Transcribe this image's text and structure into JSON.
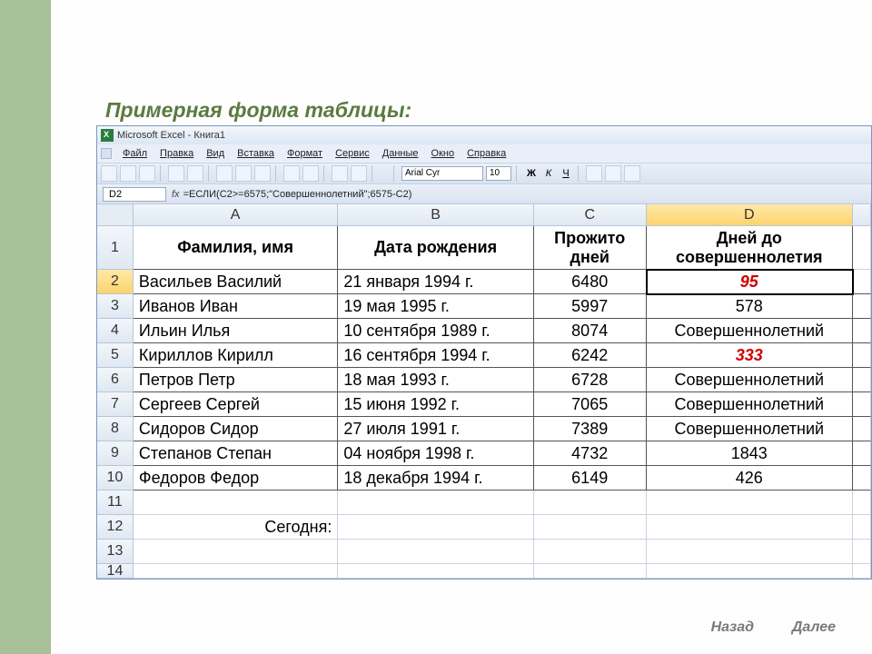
{
  "slide": {
    "title": "Примерная форма таблицы:",
    "nav_back": "Назад",
    "nav_next": "Далее"
  },
  "excel": {
    "window_title": "Microsoft Excel - Книга1",
    "menus": [
      "Файл",
      "Правка",
      "Вид",
      "Вставка",
      "Формат",
      "Сервис",
      "Данные",
      "Окно",
      "Справка"
    ],
    "font_name": "Arial Cyr",
    "font_size": "10",
    "bold": "Ж",
    "italic": "К",
    "underline": "Ч",
    "namebox": "D2",
    "formula": "=ЕСЛИ(C2>=6575;\"Совершеннолетний\";6575-C2)",
    "columns": [
      "A",
      "B",
      "C",
      "D"
    ],
    "headers": {
      "A": "Фамилия, имя",
      "B": "Дата рождения",
      "C": "Прожито дней",
      "D": "Дней до совершеннолетия"
    },
    "rows": [
      {
        "n": "2",
        "a": "Васильев Василий",
        "b": "21 января 1994 г.",
        "c": "6480",
        "d": "95",
        "d_red": true
      },
      {
        "n": "3",
        "a": "Иванов Иван",
        "b": "19 мая 1995 г.",
        "c": "5997",
        "d": "578"
      },
      {
        "n": "4",
        "a": "Ильин Илья",
        "b": "10 сентября 1989 г.",
        "c": "8074",
        "d": "Совершеннолетний"
      },
      {
        "n": "5",
        "a": "Кириллов Кирилл",
        "b": "16 сентября 1994 г.",
        "c": "6242",
        "d": "333",
        "d_red": true
      },
      {
        "n": "6",
        "a": "Петров Петр",
        "b": "18 мая 1993 г.",
        "c": "6728",
        "d": "Совершеннолетний"
      },
      {
        "n": "7",
        "a": "Сергеев Сергей",
        "b": "15 июня 1992 г.",
        "c": "7065",
        "d": "Совершеннолетний"
      },
      {
        "n": "8",
        "a": "Сидоров Сидор",
        "b": "27 июля 1991 г.",
        "c": "7389",
        "d": "Совершеннолетний"
      },
      {
        "n": "9",
        "a": "Степанов Степан",
        "b": "04 ноября 1998 г.",
        "c": "4732",
        "d": "1843"
      },
      {
        "n": "10",
        "a": "Федоров Федор",
        "b": "18 декабря 1994 г.",
        "c": "6149",
        "d": "426"
      }
    ],
    "today_label": "Сегодня:",
    "empty_rows": [
      "11",
      "12",
      "13",
      "14"
    ],
    "chart_data": {
      "type": "table",
      "title": "Примерная форма таблицы",
      "columns": [
        "Фамилия, имя",
        "Дата рождения",
        "Прожито дней",
        "Дней до совершеннолетия"
      ],
      "data": [
        [
          "Васильев Василий",
          "21 января 1994 г.",
          6480,
          95
        ],
        [
          "Иванов Иван",
          "19 мая 1995 г.",
          5997,
          578
        ],
        [
          "Ильин Илья",
          "10 сентября 1989 г.",
          8074,
          "Совершеннолетний"
        ],
        [
          "Кириллов Кирилл",
          "16 сентября 1994 г.",
          6242,
          333
        ],
        [
          "Петров Петр",
          "18 мая 1993 г.",
          6728,
          "Совершеннолетний"
        ],
        [
          "Сергеев Сергей",
          "15 июня 1992 г.",
          7065,
          "Совершеннолетний"
        ],
        [
          "Сидоров Сидор",
          "27 июля 1991 г.",
          7389,
          "Совершеннолетний"
        ],
        [
          "Степанов Степан",
          "04 ноября 1998 г.",
          4732,
          1843
        ],
        [
          "Федоров Федор",
          "18 декабря 1994 г.",
          6149,
          426
        ]
      ]
    }
  }
}
